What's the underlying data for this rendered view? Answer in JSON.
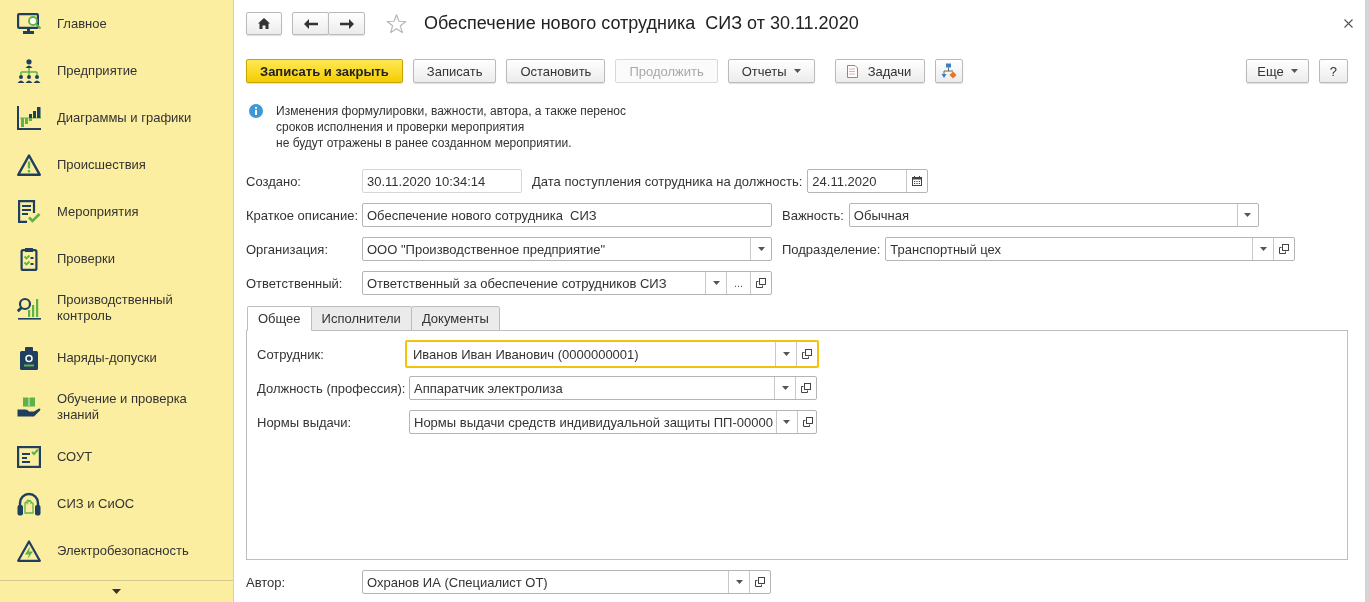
{
  "sidebar": {
    "items": [
      {
        "label": "Главное"
      },
      {
        "label": "Предприятие"
      },
      {
        "label": "Диаграммы и графики"
      },
      {
        "label": "Происшествия"
      },
      {
        "label": "Мероприятия"
      },
      {
        "label": "Проверки"
      },
      {
        "label": "Производственный контроль"
      },
      {
        "label": "Наряды-допуски"
      },
      {
        "label": "Обучение и проверка знаний"
      },
      {
        "label": "СОУТ"
      },
      {
        "label": "СИЗ и СиОС"
      },
      {
        "label": "Электробезопасность"
      }
    ]
  },
  "window": {
    "title": "Обеспечение нового сотрудника  СИЗ от 30.11.2020",
    "favorite": false
  },
  "toolbar": {
    "buttons": [
      {
        "kind": "primary",
        "label": "Записать и закрыть",
        "disabled": false
      },
      {
        "kind": "text",
        "label": "Записать",
        "disabled": false
      },
      {
        "kind": "text",
        "label": "Остановить",
        "disabled": false
      },
      {
        "kind": "text",
        "label": "Продолжить",
        "disabled": true
      },
      {
        "kind": "menu",
        "label": "Отчеты",
        "disabled": false
      },
      {
        "kind": "icon-text",
        "label": "Задачи",
        "disabled": false
      },
      {
        "kind": "icon",
        "disabled": false
      }
    ],
    "right_buttons": [
      {
        "kind": "menu",
        "label": "Еще",
        "disabled": false
      },
      {
        "kind": "text",
        "label": "?",
        "disabled": false
      }
    ]
  },
  "notice": {
    "text": "Изменения формулировки, важности, автора, а также перенос\nсроков исполнения и проверки мероприятия\nне будут отражены в ранее созданном мероприятии."
  },
  "form": {
    "rows": [
      [
        {
          "label": "Создано:",
          "value": "30.11.2020 10:34:14",
          "kind": "readonly"
        },
        {
          "label": "Дата поступления сотрудника на должность:",
          "value": "24.11.2020",
          "kind": "date"
        }
      ],
      [
        {
          "label": "Краткое описание:",
          "value": "Обеспечение нового сотрудника  СИЗ",
          "kind": "text"
        },
        {
          "label": "Важность:",
          "value": "Обычная",
          "kind": "select"
        }
      ],
      [
        {
          "label": "Организация:",
          "value": "ООО \"Производственное предприятие\"",
          "kind": "select"
        },
        {
          "label": "Подразделение:",
          "value": "Транспортный цех",
          "kind": "select-open"
        }
      ],
      [
        {
          "label": "Ответственный:",
          "value": "Ответственный за обеспечение сотрудников СИЗ",
          "kind": "select-choose-open",
          "choice_button": "..."
        }
      ]
    ]
  },
  "tabs": [
    {
      "label": "Общее",
      "selected": true
    },
    {
      "label": "Исполнители",
      "selected": false
    },
    {
      "label": "Документы",
      "selected": false
    }
  ],
  "tab_page": {
    "fields": [
      {
        "label": "Сотрудник:",
        "value": "Иванов Иван Иванович (0000000001)",
        "kind": "select-open",
        "focused": true
      },
      {
        "label": "Должность (профессия):",
        "value": "Аппаратчик электролиза",
        "kind": "select-open",
        "focused": false
      },
      {
        "label": "Нормы выдачи:",
        "value": "Нормы выдачи средств индивидуальной защиты ПП-00000",
        "kind": "select-open",
        "focused": false
      }
    ]
  },
  "author": {
    "label": "Автор:",
    "value": "Охранов ИА (Специалист ОТ)",
    "kind": "select-open"
  }
}
